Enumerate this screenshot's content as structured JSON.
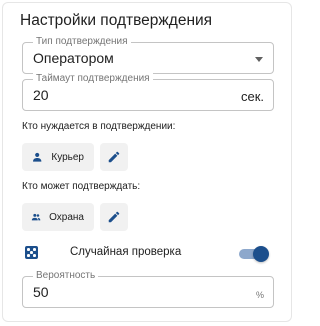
{
  "panel": {
    "title": "Настройки подтверждения"
  },
  "confirmation_type": {
    "label": "Тип подтверждения",
    "value": "Оператором",
    "icon": "chevron-down-icon"
  },
  "timeout": {
    "label": "Таймаут подтверждения",
    "value": "20",
    "unit": "сек."
  },
  "needs_confirmation": {
    "label": "Кто нуждается в подтверждении:",
    "chip_label": "Курьер",
    "chip_icon": "person-icon",
    "edit_icon": "pencil-icon"
  },
  "can_confirm": {
    "label": "Кто может подтверждать:",
    "chip_label": "Охрана",
    "chip_icon": "group-icon",
    "edit_icon": "pencil-icon"
  },
  "random_check": {
    "label": "Случайная проверка",
    "icon": "dice-icon",
    "enabled": true
  },
  "probability": {
    "label": "Вероятность",
    "value": "50",
    "unit": "%"
  },
  "colors": {
    "accent": "#1c4f8c",
    "toggle_track": "#8da8cc",
    "chip_background": "#f1f1f1",
    "border": "#c4c4c4"
  }
}
